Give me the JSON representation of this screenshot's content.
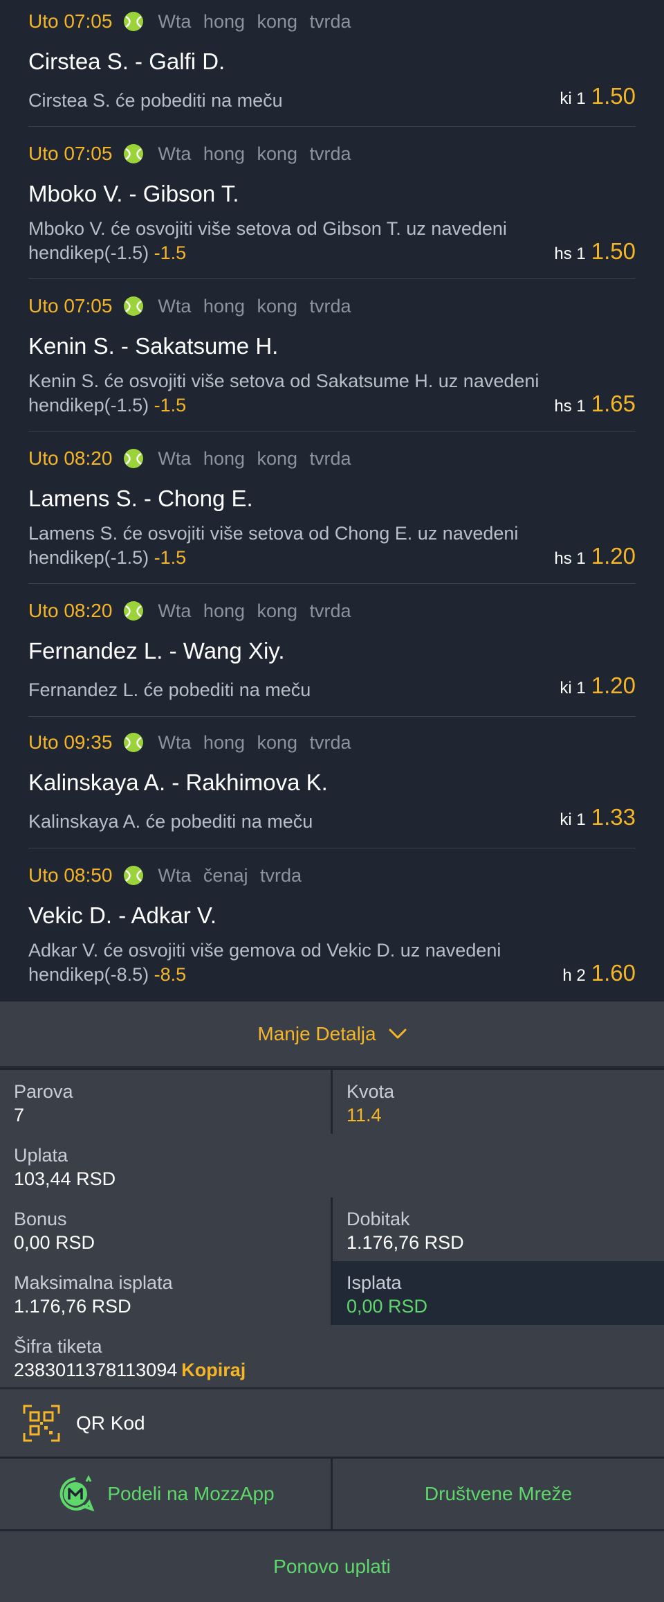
{
  "matches": [
    {
      "time": "Uto 07:05",
      "league": "Wta hong kong tvrda",
      "title": "Cirstea S. - Galfi D.",
      "desc": "Cirstea S. će pobediti na meču",
      "handicap": "",
      "code": "ki 1",
      "odd": "1.50"
    },
    {
      "time": "Uto 07:05",
      "league": "Wta hong kong tvrda",
      "title": "Mboko V. - Gibson T.",
      "desc": "Mboko V. će osvojiti više setova od Gibson T. uz navedeni hendikep(-1.5)",
      "handicap": "-1.5",
      "code": "hs 1",
      "odd": "1.50"
    },
    {
      "time": "Uto 07:05",
      "league": "Wta hong kong tvrda",
      "title": "Kenin S. - Sakatsume H.",
      "desc": "Kenin S. će osvojiti više setova od Sakatsume H. uz navedeni hendikep(-1.5)",
      "handicap": "-1.5",
      "code": "hs 1",
      "odd": "1.65"
    },
    {
      "time": "Uto 08:20",
      "league": "Wta hong kong tvrda",
      "title": "Lamens S. - Chong E.",
      "desc": "Lamens S. će osvojiti više setova od Chong E. uz navedeni hendikep(-1.5)",
      "handicap": "-1.5",
      "code": "hs 1",
      "odd": "1.20"
    },
    {
      "time": "Uto 08:20",
      "league": "Wta hong kong tvrda",
      "title": "Fernandez L. - Wang Xiy.",
      "desc": "Fernandez L. će pobediti na meču",
      "handicap": "",
      "code": "ki 1",
      "odd": "1.20"
    },
    {
      "time": "Uto 09:35",
      "league": "Wta hong kong tvrda",
      "title": "Kalinskaya A. - Rakhimova K.",
      "desc": "Kalinskaya A. će pobediti na meču",
      "handicap": "",
      "code": "ki 1",
      "odd": "1.33"
    },
    {
      "time": "Uto 08:50",
      "league": "Wta čenaj tvrda",
      "title": "Vekic D. - Adkar V.",
      "desc": "Adkar V. će osvojiti više gemova od Vekic D. uz navedeni hendikep(-8.5)",
      "handicap": "-8.5",
      "code": "h 2",
      "odd": "1.60"
    }
  ],
  "details_toggle": "Manje Detalja",
  "summary": {
    "pairs_label": "Parova",
    "pairs_value": "7",
    "odds_label": "Kvota",
    "odds_value": "11.4",
    "stake_label": "Uplata",
    "stake_value": "103,44 RSD",
    "bonus_label": "Bonus",
    "bonus_value": "0,00 RSD",
    "win_label": "Dobitak",
    "win_value": "1.176,76 RSD",
    "max_label": "Maksimalna isplata",
    "max_value": "1.176,76 RSD",
    "payout_label": "Isplata",
    "payout_value": "0,00 RSD",
    "ticket_label": "Šifra tiketa",
    "ticket_value": "2383011378113094",
    "copy_label": "Kopiraj"
  },
  "qr_label": "QR Kod",
  "share_mozz_label": "Podeli na MozzApp",
  "share_social_label": "Društvene Mreže",
  "replay_label": "Ponovo uplati",
  "colors": {
    "accent": "#f5b529",
    "green": "#5fd86b",
    "bg": "#1f2631",
    "panel": "#3b3f48"
  }
}
